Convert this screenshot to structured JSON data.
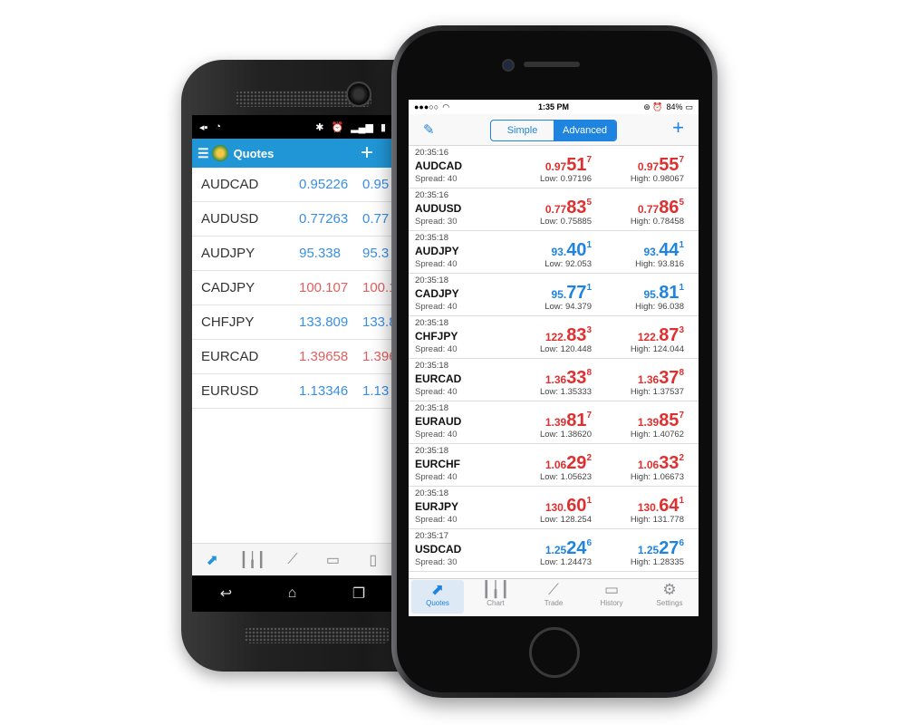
{
  "android": {
    "appbar": {
      "title": "Quotes"
    },
    "quotes": [
      {
        "symbol": "AUDCAD",
        "bid": "0.95226",
        "ask": "0.95",
        "color": "blue"
      },
      {
        "symbol": "AUDUSD",
        "bid": "0.77263",
        "ask": "0.77",
        "color": "blue"
      },
      {
        "symbol": "AUDJPY",
        "bid": "95.338",
        "ask": "95.3",
        "color": "blue"
      },
      {
        "symbol": "CADJPY",
        "bid": "100.107",
        "ask": "100.1",
        "color": "red"
      },
      {
        "symbol": "CHFJPY",
        "bid": "133.809",
        "ask": "133.8",
        "color": "blue"
      },
      {
        "symbol": "EURCAD",
        "bid": "1.39658",
        "ask": "1.396",
        "color": "red"
      },
      {
        "symbol": "EURUSD",
        "bid": "1.13346",
        "ask": "1.13",
        "color": "blue"
      }
    ]
  },
  "iphone": {
    "status": {
      "time": "1:35 PM",
      "battery": "84%"
    },
    "segment": {
      "simple": "Simple",
      "advanced": "Advanced"
    },
    "quotes": [
      {
        "time": "20:35:16",
        "symbol": "AUDCAD",
        "spread": "Spread: 40",
        "color": "red",
        "bid": {
          "s": "0.97",
          "b": "51",
          "sup": "7"
        },
        "ask": {
          "s": "0.97",
          "b": "55",
          "sup": "7"
        },
        "low": "Low: 0.97196",
        "high": "High: 0.98067"
      },
      {
        "time": "20:35:16",
        "symbol": "AUDUSD",
        "spread": "Spread: 30",
        "color": "red",
        "bid": {
          "s": "0.77",
          "b": "83",
          "sup": "5"
        },
        "ask": {
          "s": "0.77",
          "b": "86",
          "sup": "5"
        },
        "low": "Low: 0.75885",
        "high": "High: 0.78458"
      },
      {
        "time": "20:35:18",
        "symbol": "AUDJPY",
        "spread": "Spread: 40",
        "color": "blue",
        "bid": {
          "s": "93.",
          "b": "40",
          "sup": "1"
        },
        "ask": {
          "s": "93.",
          "b": "44",
          "sup": "1"
        },
        "low": "Low: 92.053",
        "high": "High: 93.816"
      },
      {
        "time": "20:35:18",
        "symbol": "CADJPY",
        "spread": "Spread: 40",
        "color": "blue",
        "bid": {
          "s": "95.",
          "b": "77",
          "sup": "1"
        },
        "ask": {
          "s": "95.",
          "b": "81",
          "sup": "1"
        },
        "low": "Low: 94.379",
        "high": "High: 96.038"
      },
      {
        "time": "20:35:18",
        "symbol": "CHFJPY",
        "spread": "Spread: 40",
        "color": "red",
        "bid": {
          "s": "122.",
          "b": "83",
          "sup": "3"
        },
        "ask": {
          "s": "122.",
          "b": "87",
          "sup": "3"
        },
        "low": "Low: 120.448",
        "high": "High: 124.044"
      },
      {
        "time": "20:35:18",
        "symbol": "EURCAD",
        "spread": "Spread: 40",
        "color": "red",
        "bid": {
          "s": "1.36",
          "b": "33",
          "sup": "8"
        },
        "ask": {
          "s": "1.36",
          "b": "37",
          "sup": "8"
        },
        "low": "Low: 1.35333",
        "high": "High: 1.37537"
      },
      {
        "time": "20:35:18",
        "symbol": "EURAUD",
        "spread": "Spread: 40",
        "color": "red",
        "bid": {
          "s": "1.39",
          "b": "81",
          "sup": "7"
        },
        "ask": {
          "s": "1.39",
          "b": "85",
          "sup": "7"
        },
        "low": "Low: 1.38620",
        "high": "High: 1.40762"
      },
      {
        "time": "20:35:18",
        "symbol": "EURCHF",
        "spread": "Spread: 40",
        "color": "red",
        "bid": {
          "s": "1.06",
          "b": "29",
          "sup": "2"
        },
        "ask": {
          "s": "1.06",
          "b": "33",
          "sup": "2"
        },
        "low": "Low: 1.05623",
        "high": "High: 1.06673"
      },
      {
        "time": "20:35:18",
        "symbol": "EURJPY",
        "spread": "Spread: 40",
        "color": "red",
        "bid": {
          "s": "130.",
          "b": "60",
          "sup": "1"
        },
        "ask": {
          "s": "130.",
          "b": "64",
          "sup": "1"
        },
        "low": "Low: 128.254",
        "high": "High: 131.778"
      },
      {
        "time": "20:35:17",
        "symbol": "USDCAD",
        "spread": "Spread: 30",
        "color": "blue",
        "bid": {
          "s": "1.25",
          "b": "24",
          "sup": "6"
        },
        "ask": {
          "s": "1.25",
          "b": "27",
          "sup": "6"
        },
        "low": "Low: 1.24473",
        "high": "High: 1.28335"
      }
    ],
    "tabs": [
      {
        "label": "Quotes",
        "icon": "quotes-icon",
        "glyph": "⬈",
        "active": true
      },
      {
        "label": "Chart",
        "icon": "chart-icon",
        "glyph": "┃╽┃",
        "active": false
      },
      {
        "label": "Trade",
        "icon": "trade-icon",
        "glyph": "⟋",
        "active": false
      },
      {
        "label": "History",
        "icon": "history-icon",
        "glyph": "▭",
        "active": false
      },
      {
        "label": "Settings",
        "icon": "settings-icon",
        "glyph": "⚙",
        "active": false
      }
    ]
  },
  "colors": {
    "blue": "#1f83e0",
    "red": "#e02f2f",
    "android_bar": "#2196d6"
  }
}
